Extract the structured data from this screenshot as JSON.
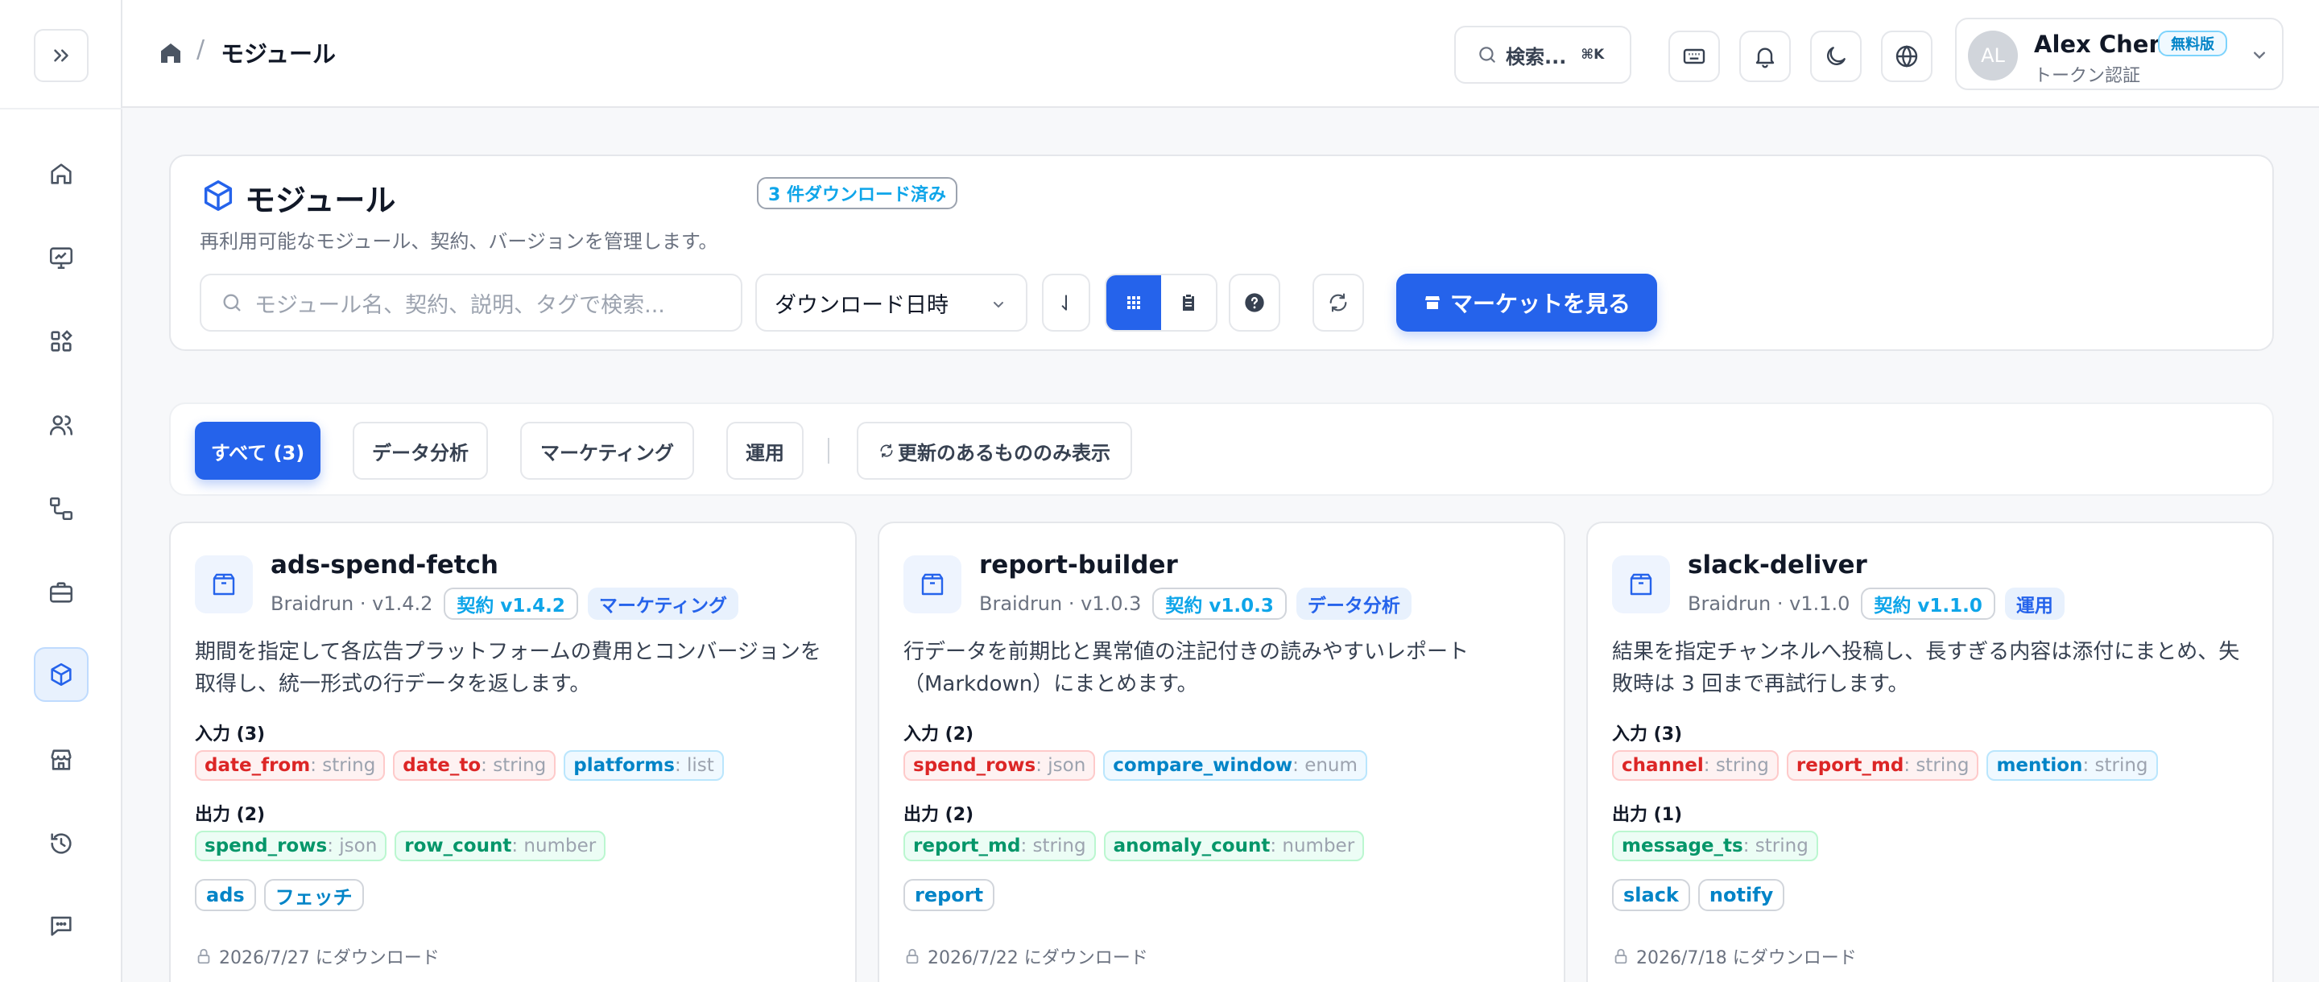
{
  "header": {
    "breadcrumb_current": "モジュール",
    "breadcrumb_sep": "/",
    "search_label": "検索...",
    "search_shortcut": "⌘K",
    "user": {
      "initials": "AL",
      "name": "Alex Chen",
      "plan_badge": "無料版",
      "auth": "トークン認証"
    }
  },
  "sidebar": {
    "items": [
      "home",
      "dashboard",
      "apps",
      "users",
      "workflows",
      "toolbox",
      "modules",
      "store",
      "history",
      "chat"
    ],
    "active": "modules"
  },
  "page": {
    "title": "モジュール",
    "download_badge": "3 件ダウンロード済み",
    "description": "再利用可能なモジュール、契約、バージョンを管理します。",
    "search_placeholder": "モジュール名、契約、説明、タグで検索...",
    "sort_value": "ダウンロード日時",
    "market_button": "マーケットを見る"
  },
  "filters": {
    "all": "すべて (3)",
    "data": "データ分析",
    "marketing": "マーケティング",
    "ops": "運用",
    "updates_only": "更新のあるもののみ表示"
  },
  "labels": {
    "input": "入力",
    "output": "出力"
  },
  "modules": [
    {
      "name": "ads-spend-fetch",
      "vendor": "Braidrun · v1.4.2",
      "contract": "契約 v1.4.2",
      "category": "マーケティング",
      "description": "期間を指定して各広告プラットフォームの費用とコンバージョンを取得し、統一形式の行データを返します。",
      "inputs_label": "入力 (3)",
      "inputs": [
        {
          "name": "date_from",
          "type": ": string",
          "color": "red"
        },
        {
          "name": "date_to",
          "type": ": string",
          "color": "red"
        },
        {
          "name": "platforms",
          "type": ": list",
          "color": "blue"
        }
      ],
      "outputs_label": "出力 (2)",
      "outputs": [
        {
          "name": "spend_rows",
          "type": ": json",
          "color": "green"
        },
        {
          "name": "row_count",
          "type": ": number",
          "color": "green"
        }
      ],
      "tags": [
        "ads",
        "フェッチ"
      ],
      "downloaded": "2026/7/27 にダウンロード"
    },
    {
      "name": "report-builder",
      "vendor": "Braidrun · v1.0.3",
      "contract": "契約 v1.0.3",
      "category": "データ分析",
      "description": "行データを前期比と異常値の注記付きの読みやすいレポート（Markdown）にまとめます。",
      "inputs_label": "入力 (2)",
      "inputs": [
        {
          "name": "spend_rows",
          "type": ": json",
          "color": "red"
        },
        {
          "name": "compare_window",
          "type": ": enum",
          "color": "blue"
        }
      ],
      "outputs_label": "出力 (2)",
      "outputs": [
        {
          "name": "report_md",
          "type": ": string",
          "color": "green"
        },
        {
          "name": "anomaly_count",
          "type": ": number",
          "color": "green"
        }
      ],
      "tags": [
        "report"
      ],
      "downloaded": "2026/7/22 にダウンロード"
    },
    {
      "name": "slack-deliver",
      "vendor": "Braidrun · v1.1.0",
      "contract": "契約 v1.1.0",
      "category": "運用",
      "description": "結果を指定チャンネルへ投稿し、長すぎる内容は添付にまとめ、失敗時は 3 回まで再試行します。",
      "inputs_label": "入力 (3)",
      "inputs": [
        {
          "name": "channel",
          "type": ": string",
          "color": "red"
        },
        {
          "name": "report_md",
          "type": ": string",
          "color": "red"
        },
        {
          "name": "mention",
          "type": ": string",
          "color": "blue"
        }
      ],
      "outputs_label": "出力 (1)",
      "outputs": [
        {
          "name": "message_ts",
          "type": ": string",
          "color": "green"
        }
      ],
      "tags": [
        "slack",
        "notify"
      ],
      "downloaded": "2026/7/18 にダウンロード"
    }
  ],
  "colors": {
    "primary": "#2563eb",
    "accent": "#0ea5e9"
  }
}
